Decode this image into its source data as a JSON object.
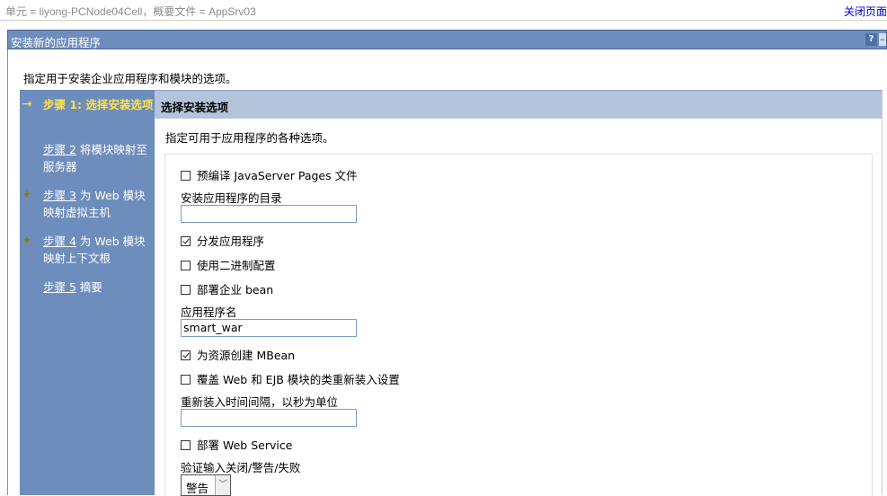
{
  "topbar": {
    "scope": "单元 = liyong-PCNode04Cell，概要文件 = AppSrv03",
    "close_link": "关闭页面"
  },
  "titlebar": {
    "title": "安装新的应用程序",
    "help": "?",
    "minimize": "–"
  },
  "intro": "指定用于安装企业应用程序和模块的选项。",
  "wizard": {
    "steps": [
      {
        "marker": "→",
        "link": "步骤 1: 选择安装选项",
        "rest": ""
      },
      {
        "marker": "",
        "link": "步骤 2",
        "rest": " 将模块映射至服务器"
      },
      {
        "marker": "✦",
        "link": "步骤 3",
        "rest": " 为 Web 模块映射虚拟主机"
      },
      {
        "marker": "✦",
        "link": "步骤 4",
        "rest": " 为 Web 模块映射上下文根"
      },
      {
        "marker": "",
        "link": "步骤 5",
        "rest": " 摘要"
      }
    ]
  },
  "content": {
    "header": "选择安装选项",
    "description": "指定可用于应用程序的各种选项。",
    "precompile_label": "预编译 JavaServer Pages 文件",
    "install_dir_label": "安装应用程序的目录",
    "install_dir_value": "",
    "distribute_label": "分发应用程序",
    "binary_config_label": "使用二进制配置",
    "deploy_ejb_label": "部署企业 bean",
    "app_name_label": "应用程序名",
    "app_name_value": "smart_war",
    "mbean_label": "为资源创建 MBean",
    "override_reload_label": "覆盖 Web 和 EJB 模块的类重新装入设置",
    "reload_interval_label": "重新装入时间间隔，以秒为单位",
    "reload_interval_value": "",
    "deploy_ws_label": "部署 Web Service",
    "validate_label": "验证输入关闭/警告/失败",
    "validate_selected": "警告"
  }
}
